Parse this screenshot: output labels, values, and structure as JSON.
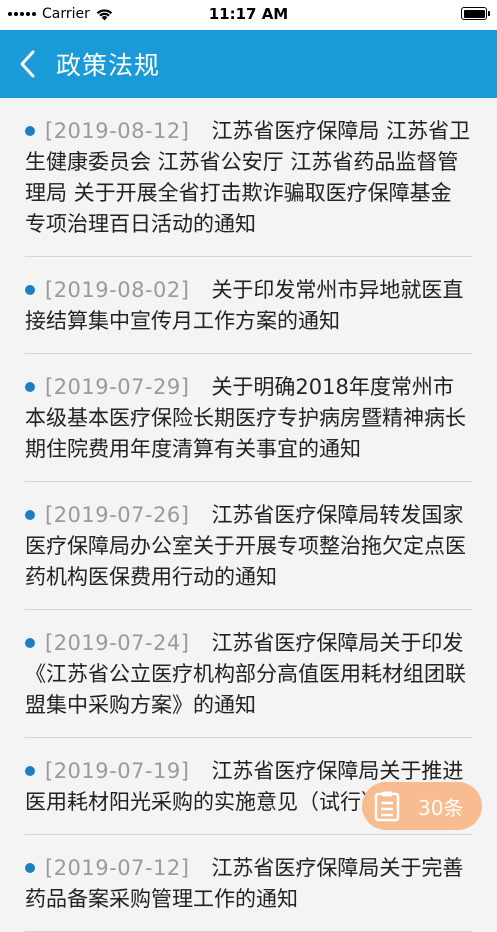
{
  "status": {
    "carrier": "Carrier",
    "time": "11:17 AM"
  },
  "nav": {
    "title": "政策法规",
    "back_icon": "chevron-left-icon"
  },
  "items": [
    {
      "date": "[2019-08-12]",
      "title": "江苏省医疗保障局 江苏省卫生健康委员会 江苏省公安厅 江苏省药品监督管理局 关于开展全省打击欺诈骗取医疗保障基金专项治理百日活动的通知"
    },
    {
      "date": "[2019-08-02]",
      "title": "关于印发常州市异地就医直接结算集中宣传月工作方案的通知"
    },
    {
      "date": "[2019-07-29]",
      "title": "关于明确2018年度常州市本级基本医疗保险长期医疗专护病房暨精神病长期住院费用年度清算有关事宜的通知"
    },
    {
      "date": "[2019-07-26]",
      "title": "江苏省医疗保障局转发国家医疗保障局办公室关于开展专项整治拖欠定点医药机构医保费用行动的通知"
    },
    {
      "date": "[2019-07-24]",
      "title": "江苏省医疗保障局关于印发《江苏省公立医疗机构部分高值医用耗材组团联盟集中采购方案》的通知"
    },
    {
      "date": "[2019-07-19]",
      "title": "江苏省医疗保障局关于推进医用耗材阳光采购的实施意见（试行）"
    },
    {
      "date": "[2019-07-12]",
      "title": "江苏省医疗保障局关于完善药品备案采购管理工作的通知"
    }
  ],
  "badge": {
    "count": "30条",
    "icon": "clipboard-list-icon"
  },
  "colors": {
    "nav": "#1a9bd8",
    "bullet": "#1b7fc4",
    "badge": "#f7bc8f"
  }
}
